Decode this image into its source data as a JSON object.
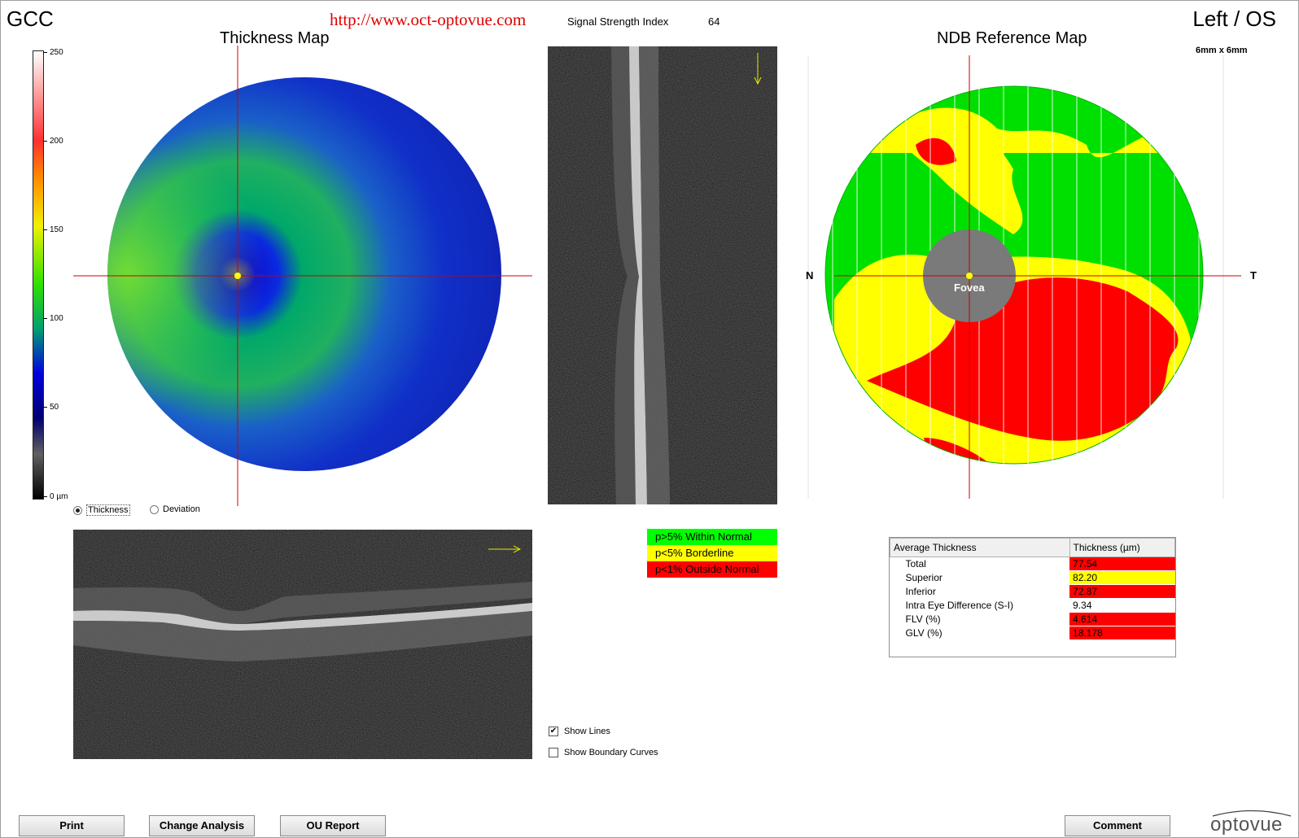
{
  "header": {
    "module": "GCC",
    "url": "http://www.oct-optovue.com",
    "ssi_label": "Signal Strength Index",
    "ssi_value": "64",
    "eye": "Left / OS"
  },
  "thickness_map": {
    "title": "Thickness Map",
    "colorbar_ticks": [
      "250",
      "200",
      "150",
      "100",
      "50",
      "0 µm"
    ],
    "radio_options": [
      {
        "label": "Thickness",
        "selected": true
      },
      {
        "label": "Deviation",
        "selected": false
      }
    ]
  },
  "ndb_map": {
    "title": "NDB Reference Map",
    "scan_size": "6mm x 6mm",
    "left_marker": "N",
    "right_marker": "T",
    "fovea_label": "Fovea"
  },
  "legend": [
    {
      "label": "p>5% Within Normal",
      "color": "#00ff00"
    },
    {
      "label": "p<5% Borderline",
      "color": "#ffff00"
    },
    {
      "label": "p<1% Outside Normal",
      "color": "#ff0000"
    }
  ],
  "checkboxes": [
    {
      "label": "Show Lines",
      "checked": true
    },
    {
      "label": "Show Boundary Curves",
      "checked": false
    }
  ],
  "avg_table": {
    "headers": [
      "Average Thickness",
      "Thickness (µm)"
    ],
    "rows": [
      {
        "label": "Total",
        "value": "77.54",
        "status": "red"
      },
      {
        "label": "Superior",
        "value": "82.20",
        "status": "yellow"
      },
      {
        "label": "Inferior",
        "value": "72.87",
        "status": "red"
      },
      {
        "label": "Intra Eye Difference (S-I)",
        "value": "9.34",
        "status": "plain"
      },
      {
        "label": "FLV (%)",
        "value": "4.614",
        "status": "red"
      },
      {
        "label": "GLV (%)",
        "value": "18.178",
        "status": "red"
      }
    ]
  },
  "buttons": {
    "print": "Print",
    "change_analysis": "Change Analysis",
    "ou_report": "OU Report",
    "comment": "Comment"
  },
  "logo": "optovue"
}
